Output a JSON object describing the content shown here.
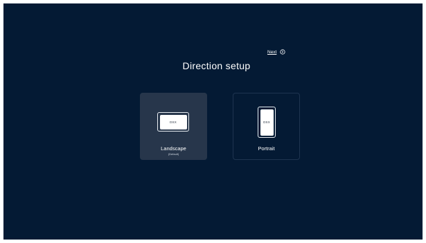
{
  "header": {
    "next_label": "Next",
    "title": "Direction setup"
  },
  "options": [
    {
      "label": "Landscape",
      "sublabel": "(Default)",
      "device_text": "DSX",
      "selected": true
    },
    {
      "label": "Portrait",
      "device_text": "DSX",
      "selected": false
    }
  ],
  "colors": {
    "background": "#041a34",
    "selected_card": "#27364b",
    "card_border": "#1f3450",
    "text": "#ffffff"
  },
  "icons": {
    "next": "circle-arrow-right-icon"
  }
}
